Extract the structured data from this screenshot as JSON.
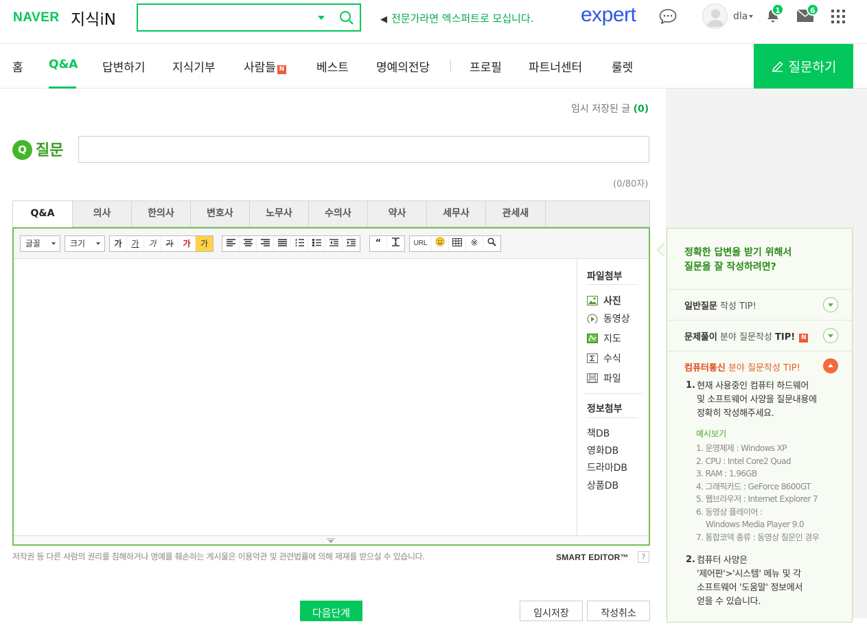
{
  "header": {
    "naver_logo": "NAVER",
    "service_name": "지식iN",
    "search_placeholder": "",
    "expert_message": "전문가라면 엑스퍼트로 모십니다.",
    "expert_logo": "expert",
    "user_name": "dla",
    "notification_count": "1",
    "mail_count": "6"
  },
  "nav": {
    "items": [
      "홈",
      "Q&A",
      "답변하기",
      "지식기부",
      "사람들",
      "베스트",
      "명예의전당",
      "프로필",
      "파트너센터",
      "룰렛"
    ],
    "new_badge": "N",
    "active": "Q&A",
    "ask_button": "질문하기"
  },
  "question": {
    "temp_saved_label": "임시 저장된 글",
    "temp_saved_count": "(0)",
    "badge": "Q",
    "label": "질문",
    "title_value": "",
    "char_count": "(0/80자)"
  },
  "category_tabs": [
    "Q&A",
    "의사",
    "한의사",
    "변호사",
    "노무사",
    "수의사",
    "약사",
    "세무사",
    "관세새"
  ],
  "toolbar": {
    "font_select": "글꼴",
    "size_select": "크기",
    "style_buttons": [
      "가",
      "가",
      "가",
      "가",
      "가",
      "가"
    ],
    "url_label": "URL"
  },
  "editor_side": {
    "attach_title": "파일첨부",
    "attach_items": [
      {
        "label": "사진",
        "icon": "photo-icon"
      },
      {
        "label": "동영상",
        "icon": "video-icon"
      },
      {
        "label": "지도",
        "icon": "map-icon"
      },
      {
        "label": "수식",
        "icon": "formula-icon"
      },
      {
        "label": "파일",
        "icon": "file-icon"
      }
    ],
    "info_title": "정보첨부",
    "info_items": [
      "책DB",
      "영화DB",
      "드라마DB",
      "상품DB"
    ]
  },
  "footer": {
    "copyright_notice": "저작권 등 다른 사람의 권리를 침해하거나 명예를 훼손하는 게시물은 이용약관 및 관련법률에 의해 제재를 받으실 수 있습니다.",
    "smart_editor": "SMART EDITOR™",
    "help": "?",
    "next_button": "다음단계",
    "temp_save_button": "임시저장",
    "cancel_button": "작성취소"
  },
  "tip_panel": {
    "heading_line1": "정확한 답변을 받기 위해서",
    "heading_line2": "질문을 잘 작성하려면?",
    "rows": [
      {
        "bold": "일반질문",
        "rest": " 작성 TIP!"
      },
      {
        "bold": "문제풀이",
        "rest": " 분야 질문작성 ",
        "tip": "TIP!",
        "badge": "N"
      }
    ],
    "open_section": {
      "bold": "컴퓨터통신",
      "rest": " 분야 질문작성 TIP!"
    },
    "tip1_num": "1.",
    "tip1_lines": [
      "현재 사용중인 컴퓨터 하드웨어",
      "및 소프트웨어 사양을 질문내용에",
      "정확히 작성해주세요."
    ],
    "example_heading": "예시보기",
    "example_lines": [
      "1. 운영체제 : Windows XP",
      "2. CPU : Intel Core2 Quad",
      "3. RAM : 1.96GB",
      "4. 그래픽카드 : GeForce 8600GT",
      "5. 웹브라우저 : Internet Explorer 7",
      "6. 동영상 플레이어 :",
      "    Windows Media Player 9.0",
      "7. 통합코덱 종류 : 동영상 질문인 경우"
    ],
    "tip2_num": "2.",
    "tip2_lines": [
      "컴퓨터 사양은",
      "'제어판'>'시스템' 메뉴 및 각",
      "소프트웨어 '도움말' 정보에서",
      "얻을 수 있습니다."
    ]
  },
  "colors": {
    "brand_green": "#03c75a",
    "expert_blue": "#2b56e6",
    "tip_orange": "#f05a28"
  }
}
